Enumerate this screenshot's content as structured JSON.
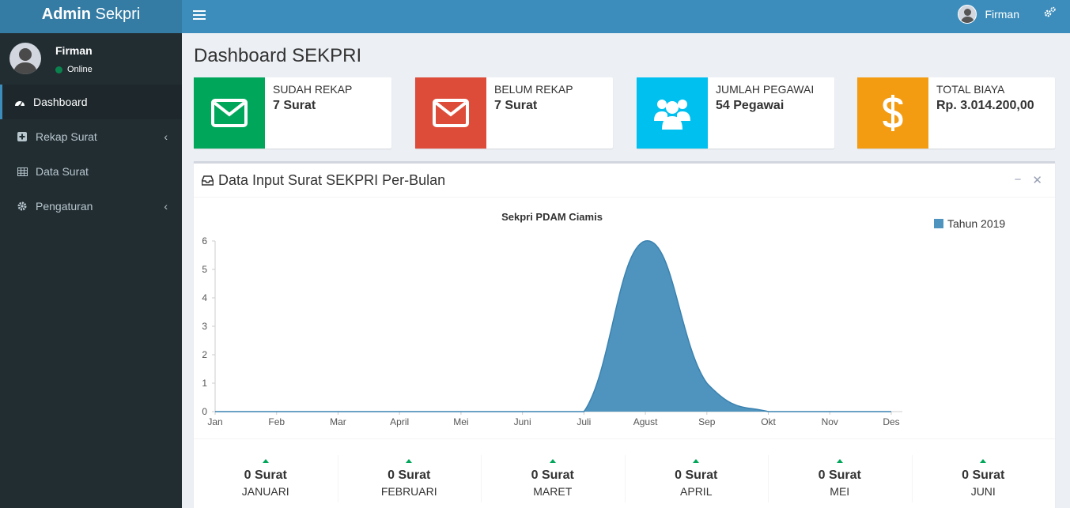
{
  "header": {
    "brand_bold": "Admin",
    "brand_light": "Sekpri",
    "user_name": "Firman"
  },
  "sidebar": {
    "user": {
      "name": "Firman",
      "status": "Online"
    },
    "items": [
      {
        "label": "Dashboard",
        "icon": "dashboard-icon"
      },
      {
        "label": "Rekap Surat",
        "icon": "plus-square-icon"
      },
      {
        "label": "Data Surat",
        "icon": "table-icon"
      },
      {
        "label": "Pengaturan",
        "icon": "gear-icon"
      }
    ]
  },
  "page": {
    "title": "Dashboard SEKPRI"
  },
  "info_boxes": [
    {
      "label": "SUDAH REKAP",
      "value": "7 Surat",
      "color": "#00a65a",
      "icon": "envelope-icon"
    },
    {
      "label": "BELUM REKAP",
      "value": "7 Surat",
      "color": "#dd4b39",
      "icon": "envelope-icon"
    },
    {
      "label": "JUMLAH PEGAWAI",
      "value": "54 Pegawai",
      "color": "#00c0ef",
      "icon": "users-icon"
    },
    {
      "label": "TOTAL BIAYA",
      "value": "Rp. 3.014.200,00",
      "color": "#f39c12",
      "icon": "dollar-icon"
    }
  ],
  "panel": {
    "title": "Data Input Surat SEKPRI Per-Bulan"
  },
  "chart_data": {
    "type": "area",
    "title": "Sekpri PDAM Ciamis",
    "categories": [
      "Jan",
      "Feb",
      "Mar",
      "April",
      "Mei",
      "Juni",
      "Juli",
      "Agust",
      "Sep",
      "Okt",
      "Nov",
      "Des"
    ],
    "series": [
      {
        "name": "Tahun 2019",
        "values": [
          0,
          0,
          0,
          0,
          0,
          0,
          0,
          6,
          1,
          0,
          0,
          0
        ],
        "color": "#4f94be"
      }
    ],
    "ylim": [
      0,
      6
    ],
    "yticks": [
      0,
      1,
      2,
      3,
      4,
      5,
      6
    ],
    "legend": "top-right"
  },
  "stats": [
    {
      "value": "0 Surat",
      "label": "JANUARI"
    },
    {
      "value": "0 Surat",
      "label": "FEBRUARI"
    },
    {
      "value": "0 Surat",
      "label": "MARET"
    },
    {
      "value": "0 Surat",
      "label": "APRIL"
    },
    {
      "value": "0 Surat",
      "label": "MEI"
    },
    {
      "value": "0 Surat",
      "label": "JUNI"
    }
  ]
}
